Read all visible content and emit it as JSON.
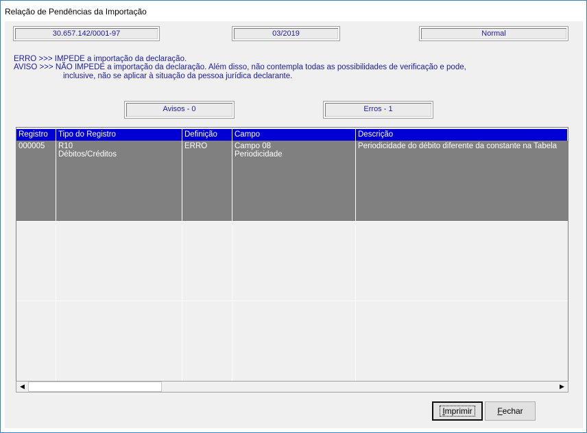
{
  "window": {
    "title": "Relação de Pendências da Importação"
  },
  "info": {
    "cnpj": "30.657.142/0001-97",
    "period": "03/2019",
    "status": "Normal"
  },
  "legend": {
    "line1": "ERRO >>> IMPEDE a importação da declaração.",
    "line2": "AVISO >>> NÃO IMPEDE a importação da declaração. Além disso, não contempla  todas as possibilidades de verificação e pode,",
    "line3": "inclusive, não se aplicar  à situação da pessoa jurídica declarante."
  },
  "counters": {
    "avisos": "Avisos - 0",
    "erros": "Erros - 1"
  },
  "table": {
    "headers": [
      "Registro",
      "Tipo do Registro",
      "Definição",
      "Campo",
      "Descrição"
    ],
    "rows": [
      {
        "registro": "000005",
        "tipo_line1": "R10",
        "tipo_line2": "Débitos/Créditos",
        "definicao": "ERRO",
        "campo_line1": "Campo 08",
        "campo_line2": "Periodicidade",
        "descricao": "Periodicidade do débito diferente da constante na Tabela"
      }
    ]
  },
  "scrollbar": {
    "left_arrow": "◀",
    "right_arrow": "▶"
  },
  "buttons": {
    "imprimir_first": "I",
    "imprimir_rest": "mprimir",
    "fechar_first": "F",
    "fechar_rest": "echar"
  }
}
